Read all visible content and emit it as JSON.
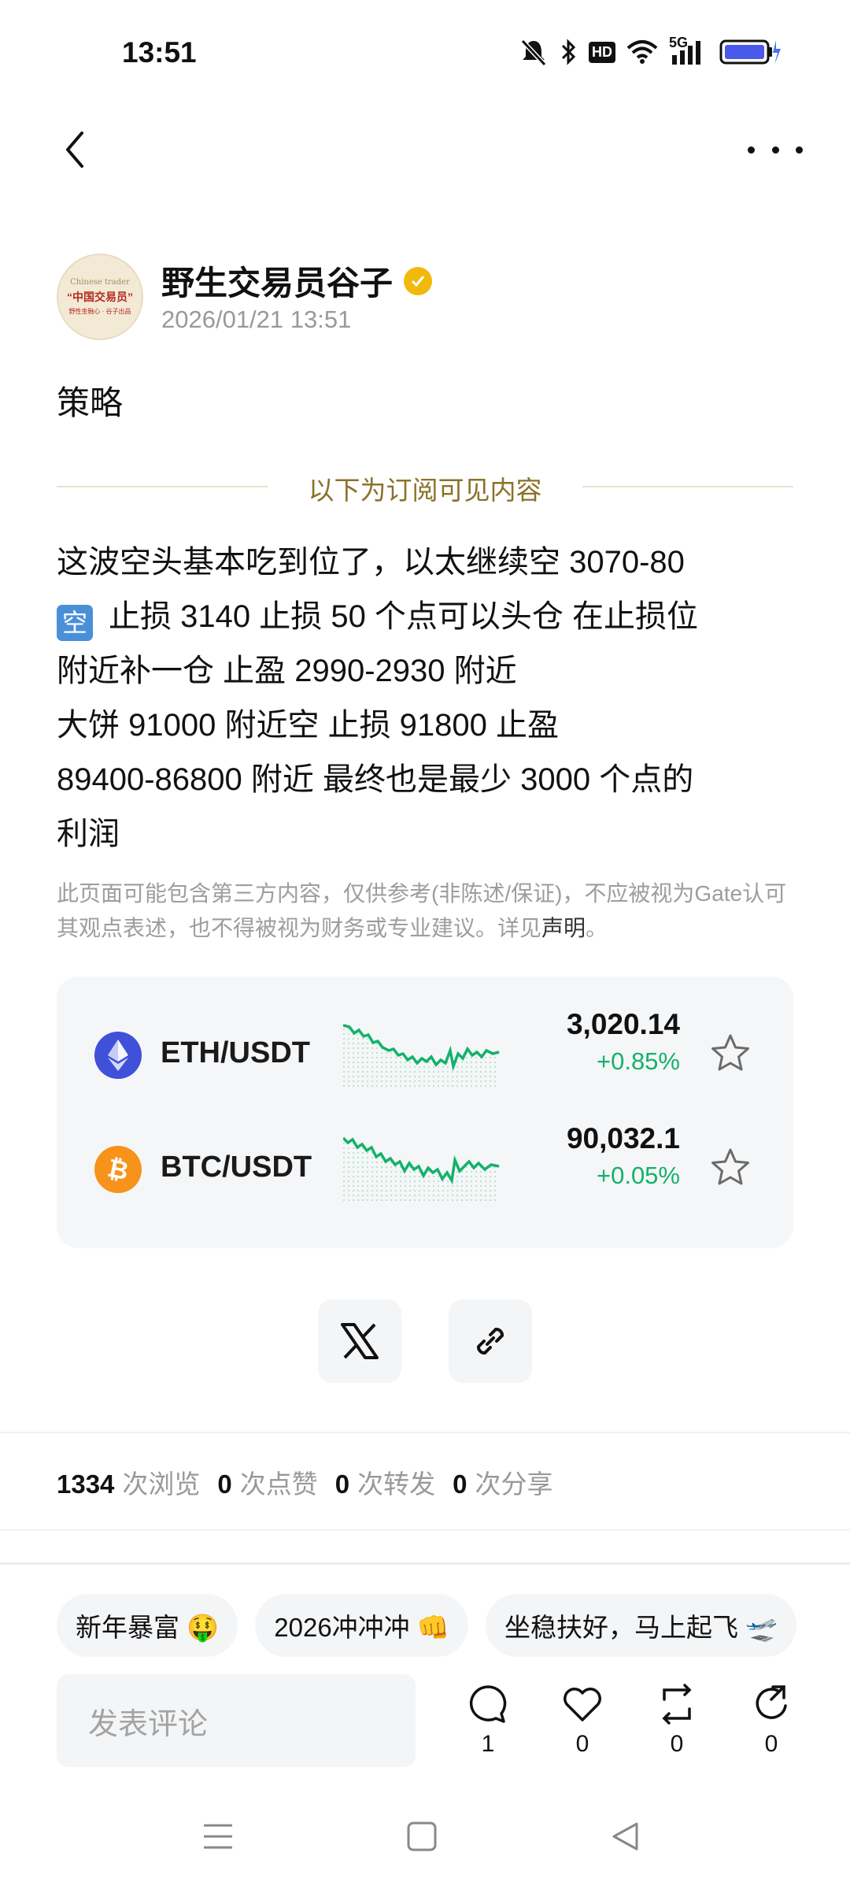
{
  "status_bar": {
    "time": "13:51",
    "hd_label": "HD",
    "network_label": "5G"
  },
  "header": {
    "back_icon": "chevron-left-icon",
    "more_icon": "more-dots-icon"
  },
  "author": {
    "avatar_lines": [
      "Chinese trader",
      "“中国交易员”",
      "野性金融心 · 谷子出品"
    ],
    "name": "野生交易员谷子",
    "verified_icon": "verified-badge-icon",
    "timestamp": "2026/01/21 13:51"
  },
  "post": {
    "title": "策略",
    "subscription_divider": "以下为订阅可见内容",
    "body": {
      "line1": "这波空头基本吃到位了，以太继续空 3070-80",
      "badge": "空",
      "line2": "止损 3140 止损 50 个点可以头仓 在止损位",
      "line3": "附近补一仓 止盈 2990-2930 附近",
      "line4": "大饼 91000 附近空 止损 91800 止盈",
      "line5": "89400-86800 附近  最终也是最少 3000 个点的",
      "line6": "利润"
    },
    "disclaimer": "此页面可能包含第三方内容，仅供参考(非陈述/保证)，不应被视为Gate认可其观点表述，也不得被视为财务或专业建议。详见",
    "disclaimer_link": "声明",
    "disclaimer_end": "。"
  },
  "market": {
    "coins": [
      {
        "pair": "ETH/USDT",
        "price": "3,020.14",
        "change": "+0.85%",
        "icon": "ethereum-icon",
        "color": "#3f51d8"
      },
      {
        "pair": "BTC/USDT",
        "price": "90,032.1",
        "change": "+0.05%",
        "icon": "bitcoin-icon",
        "color": "#f7931a"
      }
    ],
    "positive_color": "#13b26b"
  },
  "share": {
    "x_icon": "x-logo-icon",
    "link_icon": "link-icon"
  },
  "stats": {
    "views": "1334",
    "views_label": "次浏览",
    "likes": "0",
    "likes_label": "次点赞",
    "reposts": "0",
    "reposts_label": "次转发",
    "shares": "0",
    "shares_label": "次分享"
  },
  "tags": [
    "新年暴富 🤑",
    "2026冲冲冲 👊",
    "坐稳扶好，马上起飞 🛫"
  ],
  "comment_bar": {
    "placeholder": "发表评论",
    "comment_count": "1",
    "like_count": "0",
    "repost_count": "0",
    "share_count": "0"
  }
}
